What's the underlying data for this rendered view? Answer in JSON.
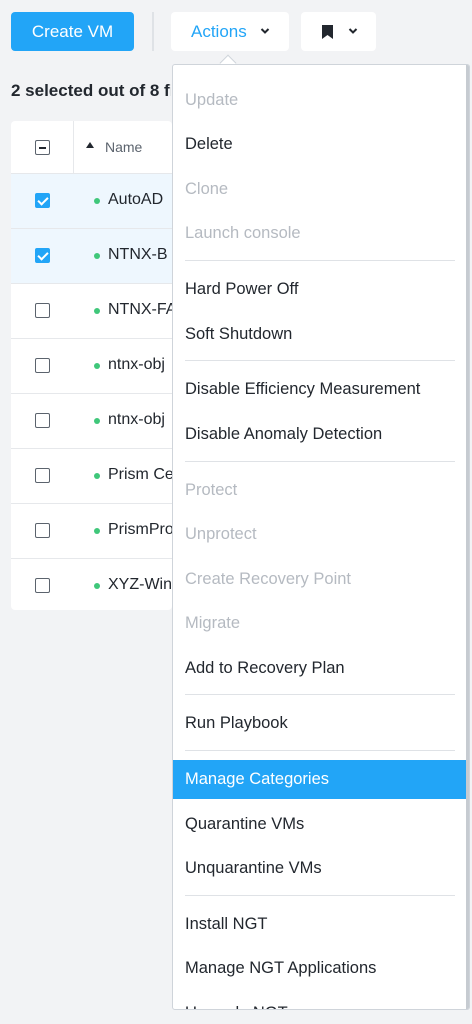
{
  "toolbar": {
    "create_label": "Create VM",
    "actions_label": "Actions"
  },
  "summary": "2 selected out of 8 fi",
  "table": {
    "header_name": "Name",
    "rows": [
      {
        "name": "AutoAD",
        "checked": true
      },
      {
        "name": "NTNX-B",
        "checked": true
      },
      {
        "name": "NTNX-FA",
        "checked": false
      },
      {
        "name": "ntnx-obj",
        "checked": false
      },
      {
        "name": "ntnx-obj",
        "checked": false
      },
      {
        "name": "Prism Ce",
        "checked": false
      },
      {
        "name": "PrismPro",
        "checked": false
      },
      {
        "name": "XYZ-Win",
        "checked": false
      }
    ]
  },
  "menu": {
    "items": [
      {
        "label": "Update",
        "disabled": true
      },
      {
        "label": "Delete",
        "disabled": false
      },
      {
        "label": "Clone",
        "disabled": true
      },
      {
        "label": "Launch console",
        "disabled": true
      },
      {
        "label": "Hard Power Off",
        "disabled": false
      },
      {
        "label": "Soft Shutdown",
        "disabled": false
      },
      {
        "label": "Disable Efficiency Measurement",
        "disabled": false
      },
      {
        "label": "Disable Anomaly Detection",
        "disabled": false
      },
      {
        "label": "Protect",
        "disabled": true
      },
      {
        "label": "Unprotect",
        "disabled": true
      },
      {
        "label": "Create Recovery Point",
        "disabled": true
      },
      {
        "label": "Migrate",
        "disabled": true
      },
      {
        "label": "Add to Recovery Plan",
        "disabled": false
      },
      {
        "label": "Run Playbook",
        "disabled": false
      },
      {
        "label": "Manage Categories",
        "disabled": false,
        "active": true
      },
      {
        "label": "Quarantine VMs",
        "disabled": false
      },
      {
        "label": "Unquarantine VMs",
        "disabled": false
      },
      {
        "label": "Install NGT",
        "disabled": false
      },
      {
        "label": "Manage NGT Applications",
        "disabled": false
      },
      {
        "label": "Upgrade NGT",
        "disabled": false
      }
    ]
  },
  "colors": {
    "accent": "#22a5f7",
    "status_on": "#3fc77a",
    "disabled_text": "#b5bac1"
  }
}
